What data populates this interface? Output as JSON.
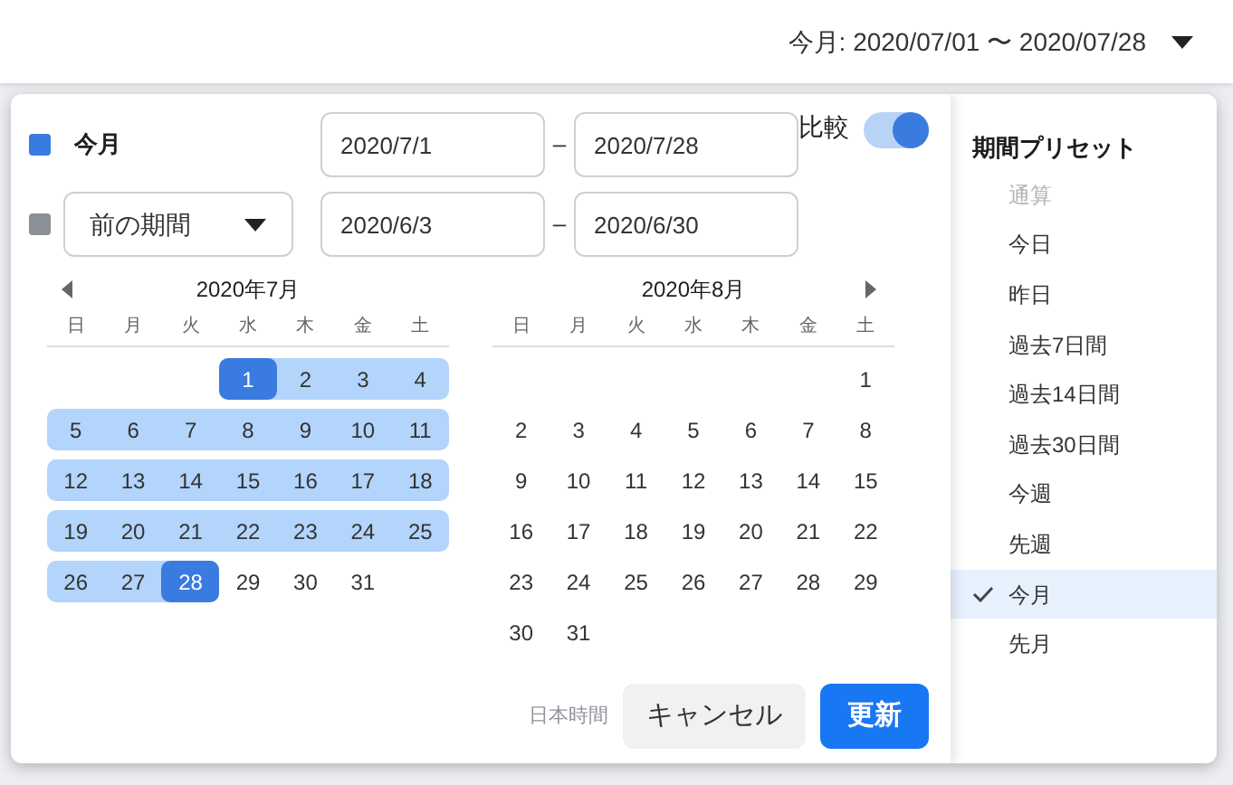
{
  "header": {
    "range_label": "今月: 2020/07/01 〜 2020/07/28"
  },
  "primary": {
    "color": "#3a7be0",
    "label": "今月",
    "start": "2020/7/1",
    "end": "2020/7/28",
    "separator": "–"
  },
  "compare_toggle": {
    "label": "比較",
    "on": true
  },
  "secondary": {
    "color": "#8a9096",
    "dropdown": "前の期間",
    "start": "2020/6/3",
    "end": "2020/6/30",
    "separator": "–"
  },
  "calendars": [
    {
      "title": "2020年7月",
      "prev_arrow": true,
      "next_arrow": false,
      "weekdays": [
        "日",
        "月",
        "火",
        "水",
        "木",
        "金",
        "土"
      ],
      "weeks": [
        [
          {
            "d": "1",
            "range": true,
            "endpoint": true
          },
          {
            "d": "2",
            "range": true,
            "endpoint": false
          },
          {
            "d": "3",
            "range": true,
            "endpoint": false
          },
          {
            "d": "4",
            "range": true,
            "endpoint": false
          }
        ],
        [
          {
            "d": "5",
            "range": true,
            "endpoint": false
          },
          {
            "d": "6",
            "range": true,
            "endpoint": false
          },
          {
            "d": "7",
            "range": true,
            "endpoint": false
          },
          {
            "d": "8",
            "range": true,
            "endpoint": false
          },
          {
            "d": "9",
            "range": true,
            "endpoint": false
          },
          {
            "d": "10",
            "range": true,
            "endpoint": false
          },
          {
            "d": "11",
            "range": true,
            "endpoint": false
          }
        ],
        [
          {
            "d": "12",
            "range": true,
            "endpoint": false
          },
          {
            "d": "13",
            "range": true,
            "endpoint": false
          },
          {
            "d": "14",
            "range": true,
            "endpoint": false
          },
          {
            "d": "15",
            "range": true,
            "endpoint": false
          },
          {
            "d": "16",
            "range": true,
            "endpoint": false
          },
          {
            "d": "17",
            "range": true,
            "endpoint": false
          },
          {
            "d": "18",
            "range": true,
            "endpoint": false
          }
        ],
        [
          {
            "d": "19",
            "range": true,
            "endpoint": false
          },
          {
            "d": "20",
            "range": true,
            "endpoint": false
          },
          {
            "d": "21",
            "range": true,
            "endpoint": false
          },
          {
            "d": "22",
            "range": true,
            "endpoint": false
          },
          {
            "d": "23",
            "range": true,
            "endpoint": false
          },
          {
            "d": "24",
            "range": true,
            "endpoint": false
          },
          {
            "d": "25",
            "range": true,
            "endpoint": false
          }
        ],
        [
          {
            "d": "26",
            "range": true,
            "endpoint": false
          },
          {
            "d": "27",
            "range": true,
            "endpoint": false
          },
          {
            "d": "28",
            "range": true,
            "endpoint": true
          },
          {
            "d": "29",
            "range": false,
            "endpoint": false
          },
          {
            "d": "30",
            "range": false,
            "endpoint": false
          },
          {
            "d": "31",
            "range": false,
            "endpoint": false
          }
        ]
      ]
    },
    {
      "title": "2020年8月",
      "prev_arrow": false,
      "next_arrow": true,
      "weekdays": [
        "日",
        "月",
        "火",
        "水",
        "木",
        "金",
        "土"
      ],
      "weeks": [
        [
          {
            "d": "1",
            "range": false,
            "endpoint": false
          }
        ],
        [
          {
            "d": "2",
            "range": false,
            "endpoint": false
          },
          {
            "d": "3",
            "range": false,
            "endpoint": false
          },
          {
            "d": "4",
            "range": false,
            "endpoint": false
          },
          {
            "d": "5",
            "range": false,
            "endpoint": false
          },
          {
            "d": "6",
            "range": false,
            "endpoint": false
          },
          {
            "d": "7",
            "range": false,
            "endpoint": false
          },
          {
            "d": "8",
            "range": false,
            "endpoint": false
          }
        ],
        [
          {
            "d": "9",
            "range": false,
            "endpoint": false
          },
          {
            "d": "10",
            "range": false,
            "endpoint": false
          },
          {
            "d": "11",
            "range": false,
            "endpoint": false
          },
          {
            "d": "12",
            "range": false,
            "endpoint": false
          },
          {
            "d": "13",
            "range": false,
            "endpoint": false
          },
          {
            "d": "14",
            "range": false,
            "endpoint": false
          },
          {
            "d": "15",
            "range": false,
            "endpoint": false
          }
        ],
        [
          {
            "d": "16",
            "range": false,
            "endpoint": false
          },
          {
            "d": "17",
            "range": false,
            "endpoint": false
          },
          {
            "d": "18",
            "range": false,
            "endpoint": false
          },
          {
            "d": "19",
            "range": false,
            "endpoint": false
          },
          {
            "d": "20",
            "range": false,
            "endpoint": false
          },
          {
            "d": "21",
            "range": false,
            "endpoint": false
          },
          {
            "d": "22",
            "range": false,
            "endpoint": false
          }
        ],
        [
          {
            "d": "23",
            "range": false,
            "endpoint": false
          },
          {
            "d": "24",
            "range": false,
            "endpoint": false
          },
          {
            "d": "25",
            "range": false,
            "endpoint": false
          },
          {
            "d": "26",
            "range": false,
            "endpoint": false
          },
          {
            "d": "27",
            "range": false,
            "endpoint": false
          },
          {
            "d": "28",
            "range": false,
            "endpoint": false
          },
          {
            "d": "29",
            "range": false,
            "endpoint": false
          }
        ],
        [
          {
            "d": "30",
            "range": false,
            "endpoint": false
          },
          {
            "d": "31",
            "range": false,
            "endpoint": false
          }
        ]
      ]
    }
  ],
  "footer": {
    "timezone": "日本時間",
    "cancel": "キャンセル",
    "apply": "更新"
  },
  "presets": {
    "title": "期間プリセット",
    "items": [
      {
        "label": "通算",
        "selected": false,
        "disabled": true
      },
      {
        "label": "今日",
        "selected": false,
        "disabled": false
      },
      {
        "label": "昨日",
        "selected": false,
        "disabled": false
      },
      {
        "label": "過去7日間",
        "selected": false,
        "disabled": false
      },
      {
        "label": "過去14日間",
        "selected": false,
        "disabled": false
      },
      {
        "label": "過去30日間",
        "selected": false,
        "disabled": false
      },
      {
        "label": "今週",
        "selected": false,
        "disabled": false
      },
      {
        "label": "先週",
        "selected": false,
        "disabled": false
      },
      {
        "label": "今月",
        "selected": true,
        "disabled": false
      },
      {
        "label": "先月",
        "selected": false,
        "disabled": false
      }
    ]
  }
}
